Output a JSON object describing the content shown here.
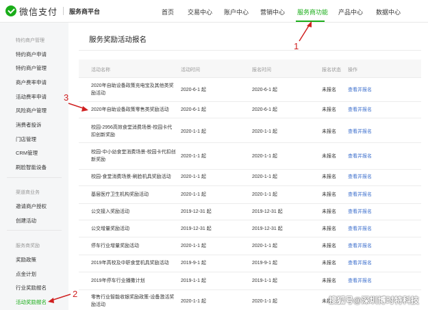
{
  "header": {
    "logo_text": "微信支付",
    "platform": "服务商平台",
    "nav": [
      "首页",
      "交易中心",
      "账户中心",
      "营销中心",
      "服务商功能",
      "产品中心",
      "数据中心"
    ],
    "active_nav": "服务商功能",
    "accent_color": "#1aad19"
  },
  "sidebar": {
    "groups": [
      {
        "title": "特约商户管理",
        "items": [
          "特约商户申请",
          "特约商户管理",
          "商户费率申请",
          "活动费率申请",
          "风险商户管理",
          "消费者投诉",
          "门店管理",
          "CRM管理",
          "刷脸智能设备"
        ]
      },
      {
        "title": "渠道商业务",
        "items": [
          "邀请商户授权",
          "创建活动"
        ]
      },
      {
        "title": "服务商奖励",
        "items": [
          "奖励政策",
          "点金计划",
          "行业奖励报名",
          "活动奖励报名"
        ]
      }
    ],
    "active_item": "活动奖励报名"
  },
  "main": {
    "title": "服务奖励活动报名",
    "columns": [
      "活动名称",
      "活动时间",
      "报名时间",
      "报名状态",
      "操作"
    ],
    "rows": [
      {
        "name": "2020年自助设备政策充电宝及其他类奖励活动",
        "time": "2020-6-1 起",
        "signup": "2020-6-1 起",
        "status": "未报名",
        "action": "查看并报名"
      },
      {
        "name": "2020年自助设备政策零售类奖励活动",
        "time": "2020-6-1 起",
        "signup": "2020-6-1 起",
        "status": "未报名",
        "action": "查看并报名"
      },
      {
        "name": "校园-2956高效食堂消费场景-校园卡代扣创新奖励",
        "time": "2020-1-1 起",
        "signup": "2020-1-1 起",
        "status": "未报名",
        "action": "查看并报名"
      },
      {
        "name": "校园-中小幼食堂消费场景-校园卡代扣创新奖励",
        "time": "2020-1-1 起",
        "signup": "2020-1-1 起",
        "status": "未报名",
        "action": "查看并报名"
      },
      {
        "name": "校园-食堂消费场景-刷脸机具奖励活动",
        "time": "2020-1-1 起",
        "signup": "2020-1-1 起",
        "status": "未报名",
        "action": "查看并报名"
      },
      {
        "name": "基层医疗卫生机构奖励活动",
        "time": "2020-1-1 起",
        "signup": "2020-1-1 起",
        "status": "未报名",
        "action": "查看并报名"
      },
      {
        "name": "公交接入奖励活动",
        "time": "2019-12-31 起",
        "signup": "2019-12-31 起",
        "status": "未报名",
        "action": "查看并报名"
      },
      {
        "name": "公交增量奖励活动",
        "time": "2019-12-31 起",
        "signup": "2019-12-31 起",
        "status": "未报名",
        "action": "查看并报名"
      },
      {
        "name": "停车行业增量奖励活动",
        "time": "2020-1-1 起",
        "signup": "2020-1-1 起",
        "status": "未报名",
        "action": "查看并报名"
      },
      {
        "name": "2019年高校及中职食堂机具奖励活动",
        "time": "2019-9-1 起",
        "signup": "2019-9-1 起",
        "status": "未报名",
        "action": "查看并报名"
      },
      {
        "name": "2019年停车行业播撒计划",
        "time": "2019-1-1 起",
        "signup": "2019-1-1 起",
        "status": "未报名",
        "action": "查看并报名"
      },
      {
        "name": "零售行业智能收银奖励政策-设备激活奖励活动",
        "time": "2020-1-1 起",
        "signup": "2020-1-1 起",
        "status": "未报名",
        "action": ""
      }
    ]
  },
  "annotations": {
    "labels": [
      "1",
      "2",
      "3"
    ],
    "color": "#d02020"
  },
  "watermark": "搜狐号@深圳博时特科技"
}
